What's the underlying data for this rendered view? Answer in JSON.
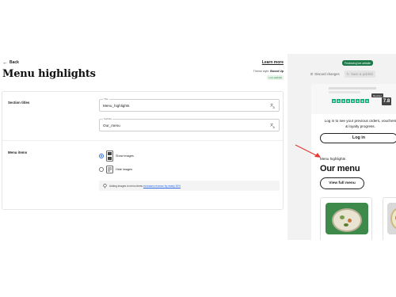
{
  "header": {
    "back_label": "Back",
    "learn_more_label": "Learn more",
    "page_title": "Menu highlights",
    "theme_style_prefix": "Theme style: ",
    "theme_style_value": "Boxed Up",
    "live_badge": "Live website"
  },
  "section_titles": {
    "heading": "Section titles",
    "title_field": {
      "label": "Title",
      "value": "Menu_highlights"
    },
    "subtitle_field": {
      "label": "Subtitle",
      "value": "Our_menu"
    }
  },
  "menu_items": {
    "heading": "Menu items",
    "options": [
      {
        "label": "Show images",
        "selected": true
      },
      {
        "label": "Hide images",
        "selected": false
      }
    ],
    "hint_text": "Adding images to menu items ",
    "hint_link": "increases revenue by nearly 30%"
  },
  "preview": {
    "badge": "Previewing live website",
    "discard_label": "Discard changes",
    "save_label": "Save & publish",
    "strip_tag": "Reorder",
    "rating_score": "7.8",
    "login_text": "Log in to see your previous orders, vouchers & loyalty progress.",
    "login_button": "Log in",
    "menu_small_title": "Menu highlights",
    "menu_big_title": "Our menu",
    "view_full_menu_button": "View full menu"
  },
  "colors": {
    "accent_green": "#1f7a4a",
    "link_blue": "#2b6be6",
    "star_green": "#00b67a",
    "annotation_red": "#e53935"
  }
}
